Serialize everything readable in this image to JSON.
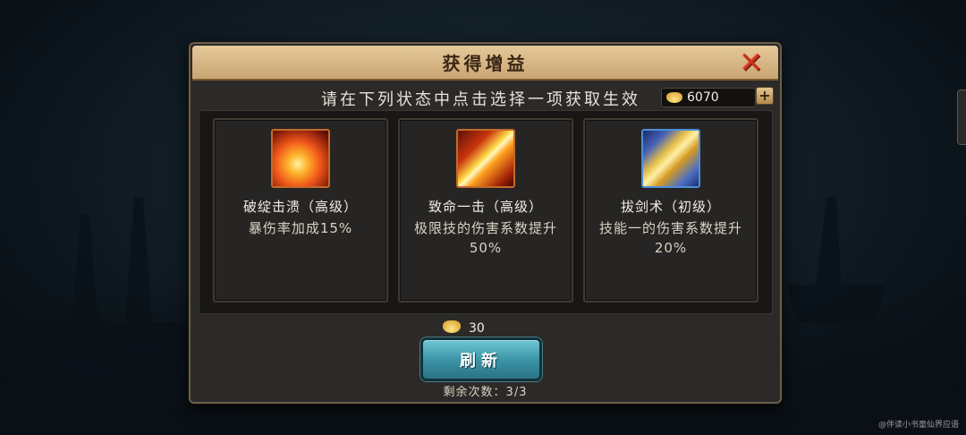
{
  "dialog": {
    "title": "获得增益",
    "instruction": "请在下列状态中点击选择一项获取生效",
    "currency": {
      "icon": "gold-ingot-icon",
      "amount": "6070"
    },
    "close_icon": "close-icon",
    "plus_label": "+"
  },
  "cards": [
    {
      "icon": "flame-burst-icon",
      "name": "破绽击溃（高级）",
      "desc": "暴伤率加成15%"
    },
    {
      "icon": "flaming-blade-icon",
      "name": "致命一击（高级）",
      "desc": "极限技的伤害系数提升50%"
    },
    {
      "icon": "sword-draw-icon",
      "name": "拔剑术（初级）",
      "desc": "技能一的伤害系数提升20%"
    }
  ],
  "refresh": {
    "cost_icon": "gold-ingot-icon",
    "cost": "30",
    "label": "刷新",
    "remaining_label": "剩余次数：",
    "remaining_value": "3/3"
  },
  "watermark": "@伴读小书童仙界应语",
  "colors": {
    "title_bar": "#d9b784",
    "close": "#c8321c",
    "refresh_button": "#3c95a8",
    "panel": "#181716"
  }
}
